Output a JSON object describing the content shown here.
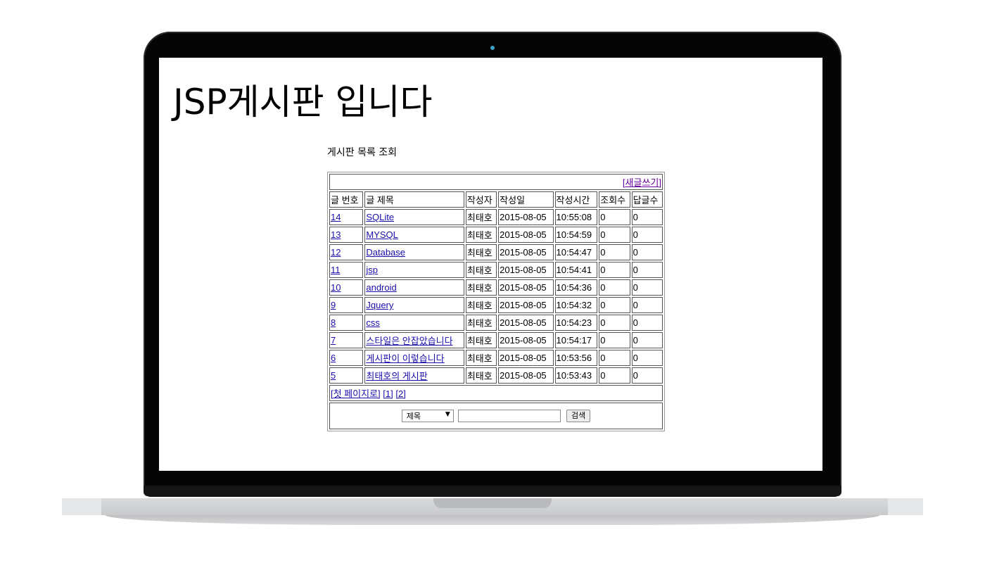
{
  "page": {
    "title": "JSP게시판 입니다",
    "subtitle": "게시판 목록 조회"
  },
  "board": {
    "write_link": "[새글쓰기]",
    "headers": [
      "글 번호",
      "글 제목",
      "작성자",
      "작성일",
      "작성시간",
      "조회수",
      "답글수"
    ],
    "rows": [
      {
        "no": "14",
        "title": "SQLite",
        "author": "최태호",
        "date": "2015-08-05",
        "time": "10:55:08",
        "views": "0",
        "replies": "0"
      },
      {
        "no": "13",
        "title": "MYSQL",
        "author": "최태호",
        "date": "2015-08-05",
        "time": "10:54:59",
        "views": "0",
        "replies": "0"
      },
      {
        "no": "12",
        "title": "Database",
        "author": "최태호",
        "date": "2015-08-05",
        "time": "10:54:47",
        "views": "0",
        "replies": "0"
      },
      {
        "no": "11",
        "title": "jsp",
        "author": "최태호",
        "date": "2015-08-05",
        "time": "10:54:41",
        "views": "0",
        "replies": "0"
      },
      {
        "no": "10",
        "title": "android",
        "author": "최태호",
        "date": "2015-08-05",
        "time": "10:54:36",
        "views": "0",
        "replies": "0"
      },
      {
        "no": "9",
        "title": "Jquery",
        "author": "최태호",
        "date": "2015-08-05",
        "time": "10:54:32",
        "views": "0",
        "replies": "0"
      },
      {
        "no": "8",
        "title": "css",
        "author": "최태호",
        "date": "2015-08-05",
        "time": "10:54:23",
        "views": "0",
        "replies": "0"
      },
      {
        "no": "7",
        "title": "스타일은 안잡았습니다",
        "author": "최태호",
        "date": "2015-08-05",
        "time": "10:54:17",
        "views": "0",
        "replies": "0"
      },
      {
        "no": "6",
        "title": "게시판이 이렇습니다",
        "author": "최태호",
        "date": "2015-08-05",
        "time": "10:53:56",
        "views": "0",
        "replies": "0"
      },
      {
        "no": "5",
        "title": "최태호의 게시판",
        "author": "최태호",
        "date": "2015-08-05",
        "time": "10:53:43",
        "views": "0",
        "replies": "0"
      }
    ],
    "pagination": {
      "first_page": "[첫 페이지로]",
      "pages": [
        "[1]",
        "[2]"
      ]
    },
    "search": {
      "field_selected": "제목",
      "query_value": "",
      "button_label": "검색"
    }
  },
  "colors": {
    "link": "#1a0dab",
    "visited_link": "#660099",
    "camera": "#3aa3c8"
  }
}
